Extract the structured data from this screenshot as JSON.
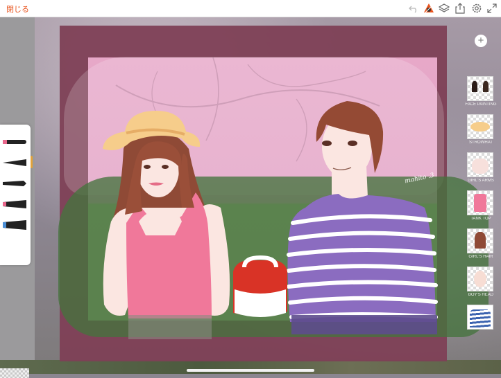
{
  "toolbar": {
    "close_label": "閉じる",
    "icons": [
      "undo-icon",
      "brush-settings-icon",
      "layers-icon",
      "share-icon",
      "settings-icon",
      "fullscreen-icon"
    ]
  },
  "colors": {
    "accent": "#e8541e",
    "frame": "#7e4056",
    "sky": "#e7a8c8",
    "grass": "#aab98a",
    "green_overlay": "#45733e",
    "stripe_shirt": "#8b6cc0",
    "tank_top": "#f0789a"
  },
  "brushes": [
    "round-brush",
    "tapered-brush",
    "flat-brush",
    "chisel-brush",
    "marker-brush",
    "calligraphy-brush"
  ],
  "layers": {
    "add_label": "+",
    "items": [
      {
        "name": "FACE PAINTING"
      },
      {
        "name": "STROWHAT"
      },
      {
        "name": "GIRL'S ARMS"
      },
      {
        "name": "TANK TOP"
      },
      {
        "name": "GIRL'S HAIR"
      },
      {
        "name": "BOY'S HEAD"
      },
      {
        "name": ""
      }
    ]
  },
  "canvas": {
    "signature": "mahito .3"
  }
}
